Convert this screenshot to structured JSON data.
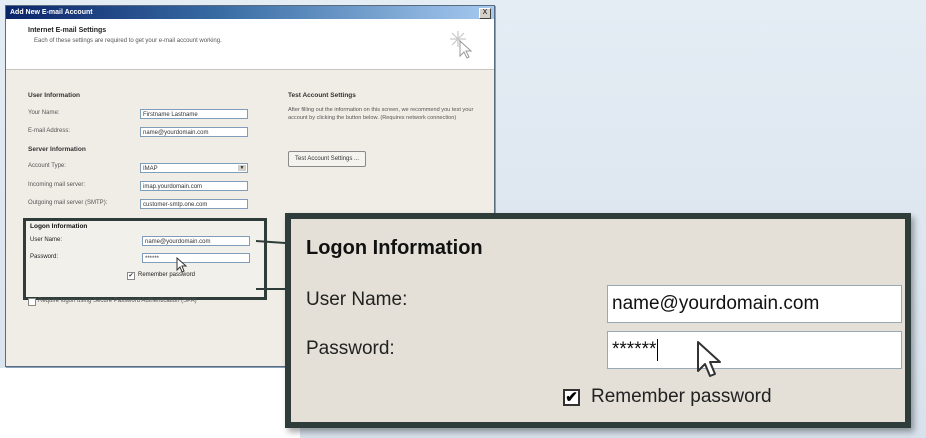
{
  "dialog": {
    "title": "Add New E-mail Account",
    "close_label": "X",
    "header_title": "Internet E-mail Settings",
    "header_subtitle": "Each of these settings are required to get your e-mail account working."
  },
  "user_info": {
    "section": "User Information",
    "name_label": "Your Name:",
    "name_value": "Firstname Lastname",
    "email_label": "E-mail Address:",
    "email_value": "name@yourdomain.com"
  },
  "server_info": {
    "section": "Server Information",
    "account_type_label": "Account Type:",
    "account_type_value": "IMAP",
    "incoming_label": "Incoming mail server:",
    "incoming_value": "imap.yourdomain.com",
    "outgoing_label": "Outgoing mail server (SMTP):",
    "outgoing_value": "customer-smtp.one.com"
  },
  "logon_info": {
    "section": "Logon Information",
    "user_label": "User Name:",
    "user_value": "name@yourdomain.com",
    "password_label": "Password:",
    "password_value": "******",
    "remember_label": "Remember password",
    "remember_checked": true
  },
  "test_settings": {
    "section": "Test Account Settings",
    "description": "After filling out the information on this screen, we recommend you test your account by clicking the button below. (Requires network connection)",
    "button_label": "Test Account Settings ..."
  },
  "spa": {
    "label": "Require logon using Secure Password Authentication (SPA)"
  },
  "zoom": {
    "title": "Logon Information",
    "user_label": "User Name:",
    "user_value": "name@yourdomain.com",
    "password_label": "Password:",
    "password_value": "******",
    "remember_label": "Remember password",
    "check_mark": "✔"
  }
}
